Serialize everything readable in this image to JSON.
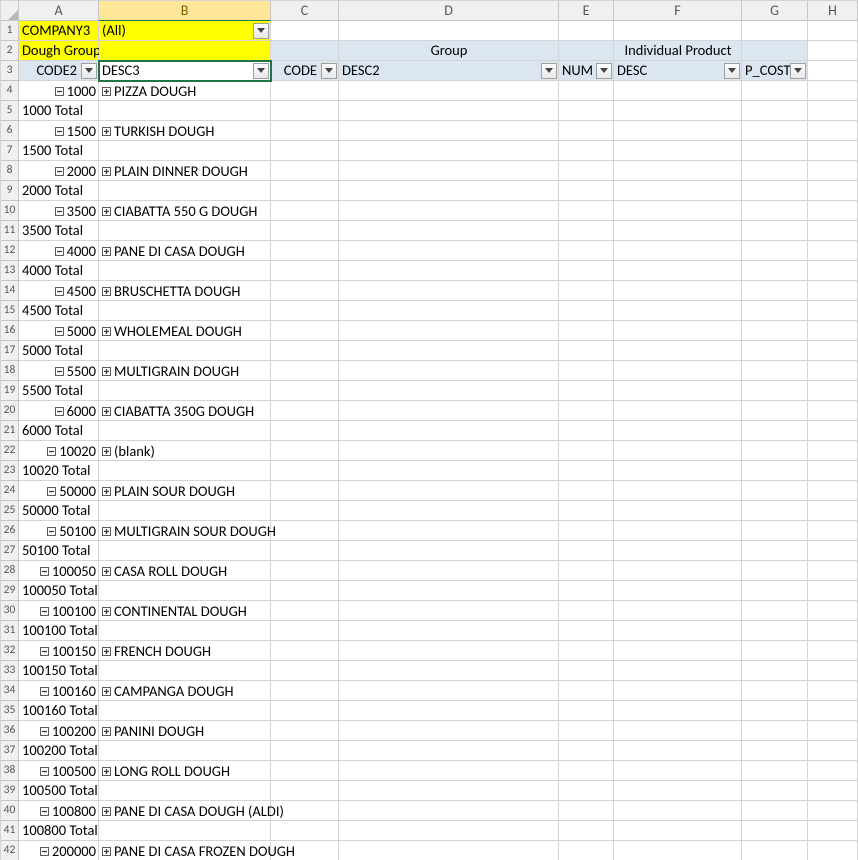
{
  "columns": [
    "A",
    "B",
    "C",
    "D",
    "E",
    "F",
    "G",
    "H"
  ],
  "selectedColumn": "B",
  "top": {
    "company_label": "COMPANY3",
    "all_value": "(All)",
    "dough_group": "Dough Group",
    "group": "Group",
    "individual_product": "Individual Product"
  },
  "headers": {
    "a": "CODE2",
    "b": "DESC3",
    "c": "CODE",
    "d": "DESC2",
    "e": "NUM",
    "f": "DESC",
    "g": "P_COST"
  },
  "rows": [
    {
      "code": "1000",
      "desc": "PIZZA DOUGH",
      "outA": "minus",
      "outB": "plus"
    },
    {
      "total": "1000 Total"
    },
    {
      "code": "1500",
      "desc": "TURKISH DOUGH",
      "outA": "minus",
      "outB": "plus"
    },
    {
      "total": "1500 Total"
    },
    {
      "code": "2000",
      "desc": "PLAIN DINNER DOUGH",
      "outA": "minus",
      "outB": "plus"
    },
    {
      "total": "2000 Total"
    },
    {
      "code": "3500",
      "desc": "CIABATTA 550 G DOUGH",
      "outA": "minus",
      "outB": "plus"
    },
    {
      "total": "3500 Total"
    },
    {
      "code": "4000",
      "desc": "PANE DI CASA DOUGH",
      "outA": "minus",
      "outB": "plus"
    },
    {
      "total": "4000 Total"
    },
    {
      "code": "4500",
      "desc": "BRUSCHETTA DOUGH",
      "outA": "minus",
      "outB": "plus"
    },
    {
      "total": "4500 Total"
    },
    {
      "code": "5000",
      "desc": "WHOLEMEAL DOUGH",
      "outA": "minus",
      "outB": "plus"
    },
    {
      "total": "5000 Total"
    },
    {
      "code": "5500",
      "desc": "MULTIGRAIN DOUGH",
      "outA": "minus",
      "outB": "plus"
    },
    {
      "total": "5500 Total"
    },
    {
      "code": "6000",
      "desc": "CIABATTA 350G DOUGH",
      "outA": "minus",
      "outB": "plus"
    },
    {
      "total": "6000 Total"
    },
    {
      "code": "10020",
      "desc": "(blank)",
      "outA": "minus",
      "outB": "plus"
    },
    {
      "total": "10020 Total"
    },
    {
      "code": "50000",
      "desc": "PLAIN SOUR DOUGH",
      "outA": "minus",
      "outB": "plus"
    },
    {
      "total": "50000 Total"
    },
    {
      "code": "50100",
      "desc": "MULTIGRAIN SOUR DOUGH",
      "outA": "minus",
      "outB": "plus"
    },
    {
      "total": "50100 Total"
    },
    {
      "code": "100050",
      "desc": "CASA ROLL DOUGH",
      "outA": "minus",
      "outB": "plus"
    },
    {
      "total": "100050 Total"
    },
    {
      "code": "100100",
      "desc": "CONTINENTAL DOUGH",
      "outA": "minus",
      "outB": "plus"
    },
    {
      "total": "100100 Total"
    },
    {
      "code": "100150",
      "desc": "FRENCH DOUGH",
      "outA": "minus",
      "outB": "plus"
    },
    {
      "total": "100150 Total"
    },
    {
      "code": "100160",
      "desc": "CAMPANGA DOUGH",
      "outA": "minus",
      "outB": "plus"
    },
    {
      "total": "100160 Total"
    },
    {
      "code": "100200",
      "desc": "PANINI DOUGH",
      "outA": "minus",
      "outB": "plus"
    },
    {
      "total": "100200 Total"
    },
    {
      "code": "100500",
      "desc": "LONG ROLL DOUGH",
      "outA": "minus",
      "outB": "plus"
    },
    {
      "total": "100500 Total"
    },
    {
      "code": "100800",
      "desc": "PANE DI CASA DOUGH (ALDI)",
      "outA": "minus",
      "outB": "plus"
    },
    {
      "total": "100800 Total"
    },
    {
      "code": "200000",
      "desc": "PANE DI CASA FROZEN DOUGH",
      "outA": "minus",
      "outB": "plus"
    }
  ]
}
